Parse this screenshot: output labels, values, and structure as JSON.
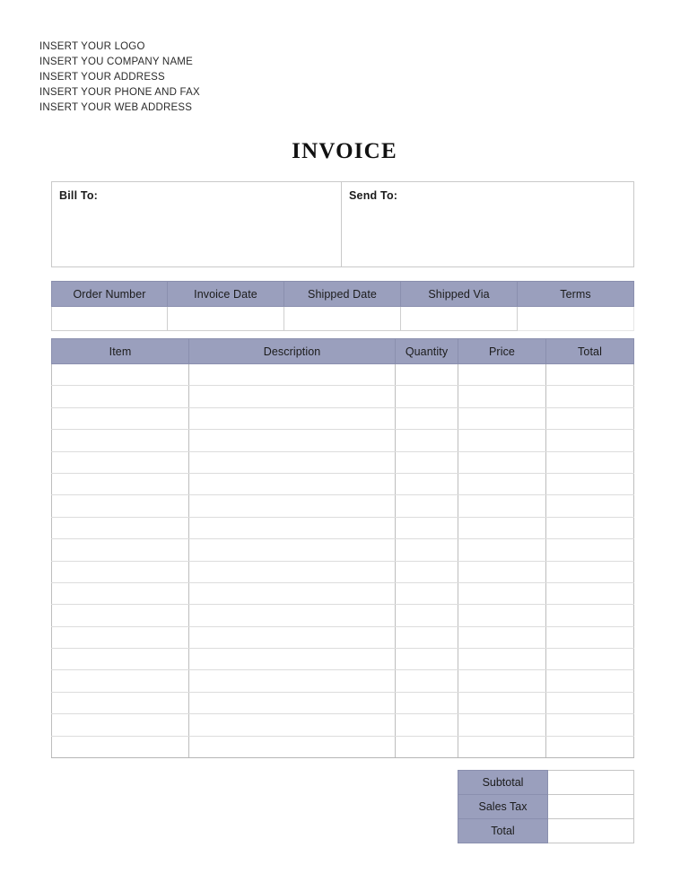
{
  "document": {
    "title": "INVOICE"
  },
  "company": {
    "lines": [
      "INSERT YOUR LOGO",
      "INSERT YOU COMPANY NAME",
      "INSERT YOUR ADDRESS",
      "INSERT YOUR PHONE AND FAX",
      "INSERT YOUR WEB ADDRESS"
    ]
  },
  "addresses": {
    "bill_to_label": "Bill To:",
    "bill_to_value": "",
    "send_to_label": "Send To:",
    "send_to_value": ""
  },
  "order_info": {
    "headers": [
      "Order Number",
      "Invoice Date",
      "Shipped Date",
      "Shipped Via",
      "Terms"
    ],
    "values": [
      "",
      "",
      "",
      "",
      ""
    ]
  },
  "items": {
    "headers": [
      "Item",
      "Description",
      "Quantity",
      "Price",
      "Total"
    ],
    "rows": [
      [
        "",
        "",
        "",
        "",
        ""
      ],
      [
        "",
        "",
        "",
        "",
        ""
      ],
      [
        "",
        "",
        "",
        "",
        ""
      ],
      [
        "",
        "",
        "",
        "",
        ""
      ],
      [
        "",
        "",
        "",
        "",
        ""
      ],
      [
        "",
        "",
        "",
        "",
        ""
      ],
      [
        "",
        "",
        "",
        "",
        ""
      ],
      [
        "",
        "",
        "",
        "",
        ""
      ],
      [
        "",
        "",
        "",
        "",
        ""
      ],
      [
        "",
        "",
        "",
        "",
        ""
      ],
      [
        "",
        "",
        "",
        "",
        ""
      ],
      [
        "",
        "",
        "",
        "",
        ""
      ],
      [
        "",
        "",
        "",
        "",
        ""
      ],
      [
        "",
        "",
        "",
        "",
        ""
      ],
      [
        "",
        "",
        "",
        "",
        ""
      ],
      [
        "",
        "",
        "",
        "",
        ""
      ],
      [
        "",
        "",
        "",
        "",
        ""
      ],
      [
        "",
        "",
        "",
        "",
        ""
      ]
    ]
  },
  "totals": {
    "rows": [
      {
        "label": "Subtotal",
        "value": ""
      },
      {
        "label": "Sales Tax",
        "value": ""
      },
      {
        "label": "Total",
        "value": ""
      }
    ]
  },
  "colors": {
    "header_fill": "#9a9fbd",
    "header_border": "#8a8fae",
    "grid_line": "#dcdcdc",
    "box_border": "#c9c9c9",
    "text": "#222222",
    "page_background": "#ffffff"
  }
}
